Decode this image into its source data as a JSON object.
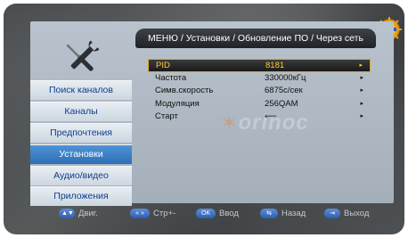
{
  "header": {
    "breadcrumb": "МЕНЮ / Установки / Обновление ПО / Через сеть"
  },
  "sidebar": {
    "items": [
      {
        "label": "Поиск каналов",
        "active": false
      },
      {
        "label": "Каналы",
        "active": false
      },
      {
        "label": "Предпочтения",
        "active": false
      },
      {
        "label": "Установки",
        "active": true
      },
      {
        "label": "Аудио/видео",
        "active": false
      },
      {
        "label": "Приложения",
        "active": false
      }
    ]
  },
  "settings": {
    "rows": [
      {
        "label": "PID",
        "value": "8181",
        "selected": true
      },
      {
        "label": "Частота",
        "value": "330000кГц",
        "selected": false
      },
      {
        "label": "Симв.скорость",
        "value": "6875с/сек",
        "selected": false
      },
      {
        "label": "Модуляция",
        "value": "256QAM",
        "selected": false
      },
      {
        "label": "Старт",
        "value": "⟵",
        "selected": false
      }
    ],
    "row_arrow": "▸"
  },
  "watermark": {
    "text": "orinoc"
  },
  "footer": {
    "hints": [
      {
        "key": "▲▼",
        "label": "Двиг."
      },
      {
        "key": "«  »",
        "label": "Стр+-"
      },
      {
        "key": "OK",
        "label": "Ввод"
      },
      {
        "key": "⇆",
        "label": "Назад"
      },
      {
        "key": "⇥",
        "label": "Выход"
      }
    ]
  },
  "colors": {
    "accent": "#2e6fb8",
    "selected_text": "#ffcb2c",
    "selected_border": "#e2a41d",
    "menu_text": "#0f3d8f"
  }
}
